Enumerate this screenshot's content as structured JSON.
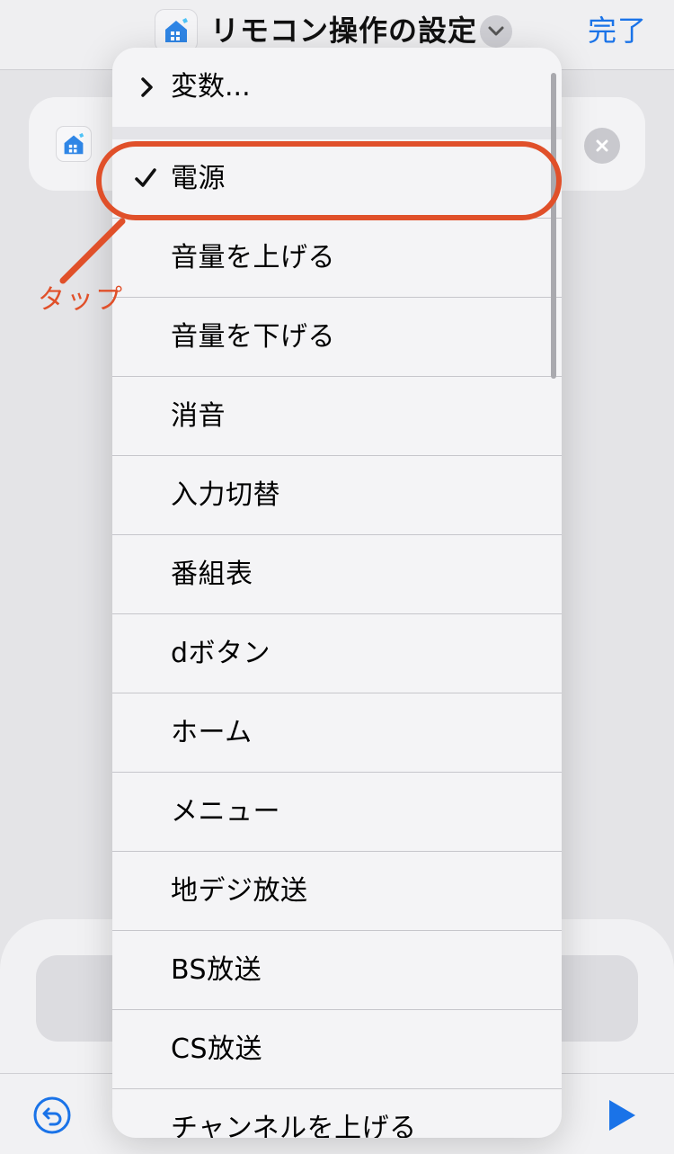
{
  "header": {
    "title": "リモコン操作の設定",
    "done_label": "完了",
    "app_icon": "home-app-icon",
    "chevron_icon": "chevron-down-icon"
  },
  "background_card": {
    "app_icon": "home-app-icon",
    "close_icon": "close-icon"
  },
  "menu": {
    "variables_label": "変数...",
    "items": [
      {
        "label": "電源",
        "checked": true
      },
      {
        "label": "音量を上げる",
        "checked": false
      },
      {
        "label": "音量を下げる",
        "checked": false
      },
      {
        "label": "消音",
        "checked": false
      },
      {
        "label": "入力切替",
        "checked": false
      },
      {
        "label": "番組表",
        "checked": false
      },
      {
        "label": "dボタン",
        "checked": false
      },
      {
        "label": "ホーム",
        "checked": false
      },
      {
        "label": "メニュー",
        "checked": false
      },
      {
        "label": "地デジ放送",
        "checked": false
      },
      {
        "label": "BS放送",
        "checked": false
      },
      {
        "label": "CS放送",
        "checked": false
      },
      {
        "label": "チャンネルを上げる",
        "checked": false
      }
    ]
  },
  "annotation": {
    "text": "タップ",
    "color": "#e0502a"
  },
  "toolbar": {
    "undo_icon": "undo-icon",
    "play_icon": "play-icon"
  },
  "colors": {
    "accent": "#1a73e8",
    "annotation": "#e0502a"
  }
}
